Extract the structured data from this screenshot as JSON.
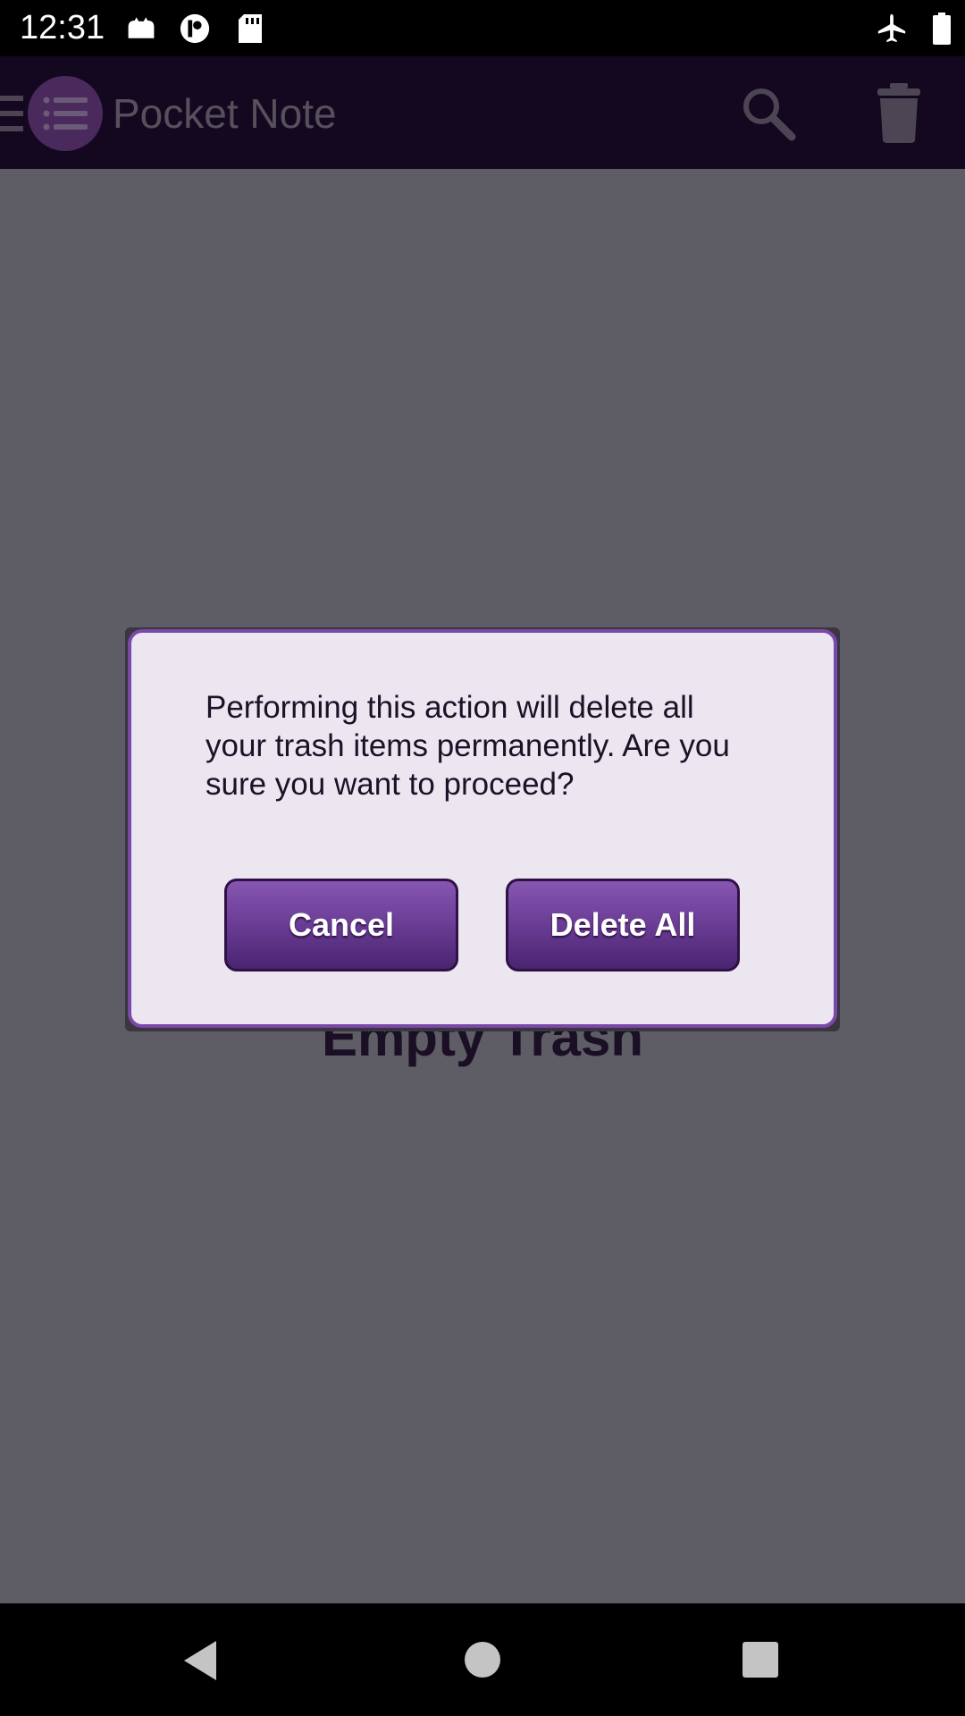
{
  "status_bar": {
    "time": "12:31",
    "icons": [
      "cat-notification-icon",
      "vpn-key-icon",
      "sd-card-icon",
      "airplane-mode-icon",
      "battery-icon"
    ]
  },
  "app_bar": {
    "title": "Pocket Note",
    "icons": [
      "menu-icon",
      "list-logo-icon",
      "search-icon",
      "trash-icon"
    ]
  },
  "background": {
    "empty_label": "Empty Trash"
  },
  "dialog": {
    "message": "Performing this action will delete all your trash items permanently. Are you sure you want to proceed?",
    "cancel_label": "Cancel",
    "confirm_label": "Delete All"
  },
  "nav_bar": {
    "icons": [
      "back-icon",
      "home-icon",
      "recents-icon"
    ]
  },
  "colors": {
    "scrim": "#5e5c64",
    "app_bar": "#140820",
    "dialog_bg": "#ece6f0",
    "dialog_border": "#7a48a8",
    "button_top": "#8656b0",
    "button_bottom": "#4a2470"
  }
}
